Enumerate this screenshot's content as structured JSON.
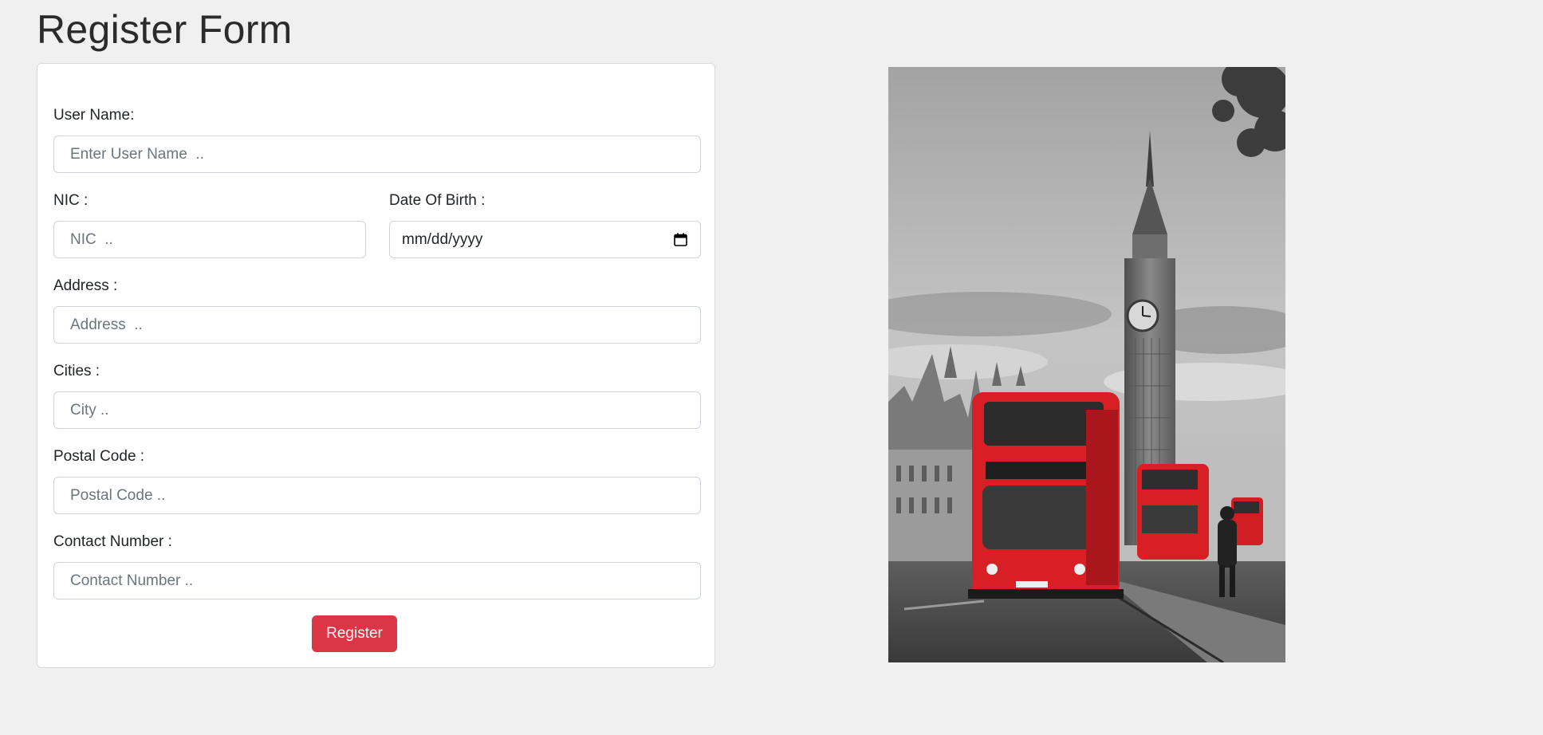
{
  "page": {
    "title": "Register Form"
  },
  "form": {
    "username": {
      "label": "User Name:",
      "placeholder": "Enter User Name  .."
    },
    "nic": {
      "label": "NIC :",
      "placeholder": "NIC  .."
    },
    "dob": {
      "label": "Date Of Birth :",
      "value": "mm/dd/yyyy"
    },
    "address": {
      "label": "Address :",
      "placeholder": "Address  .."
    },
    "city": {
      "label": "Cities :",
      "placeholder": "City .."
    },
    "postal": {
      "label": "Postal Code :",
      "placeholder": "Postal Code .."
    },
    "contact": {
      "label": "Contact Number :",
      "placeholder": "Contact Number .."
    },
    "submit_label": "Register"
  },
  "colors": {
    "accent": "#dc3545",
    "background": "#f0f0f0"
  },
  "icons": {
    "date_picker": "calendar-icon"
  }
}
